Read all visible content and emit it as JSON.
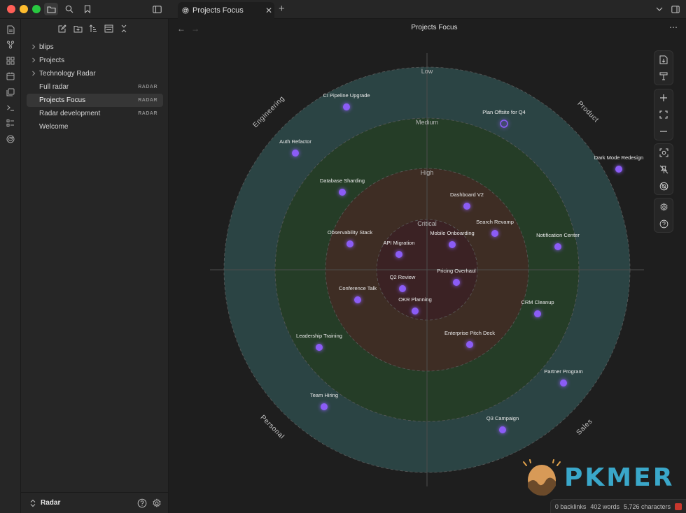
{
  "tab": {
    "title": "Projects Focus"
  },
  "sidebar": {
    "items": [
      {
        "label": "blips",
        "folder": true,
        "badge": ""
      },
      {
        "label": "Projects",
        "folder": true,
        "badge": ""
      },
      {
        "label": "Technology Radar",
        "folder": true,
        "badge": ""
      },
      {
        "label": "Full radar",
        "folder": false,
        "badge": "RADAR"
      },
      {
        "label": "Projects Focus",
        "folder": false,
        "badge": "RADAR",
        "selected": true
      },
      {
        "label": "Radar development",
        "folder": false,
        "badge": "RADAR"
      },
      {
        "label": "Welcome",
        "folder": false,
        "badge": ""
      }
    ],
    "vault_name": "Radar"
  },
  "view": {
    "title": "Projects Focus",
    "back_icon": "arrow-left-icon",
    "forward_icon": "arrow-right-icon",
    "more_label": "⋯"
  },
  "radar": {
    "rings": [
      "Low",
      "Medium",
      "High",
      "Critical"
    ],
    "ring_colors": [
      "#2b4444",
      "#253d27",
      "#3e2d24",
      "#3b2224"
    ],
    "quadrants": [
      "Engineering",
      "Product",
      "Sales",
      "Personal"
    ],
    "blip_color": "#8b5cf6",
    "blips": [
      {
        "label": "CI Pipeline Upgrade",
        "quadrant": "Engineering",
        "ring": "Low"
      },
      {
        "label": "Auth Refactor",
        "quadrant": "Engineering",
        "ring": "Low"
      },
      {
        "label": "Database Sharding",
        "quadrant": "Engineering",
        "ring": "Medium"
      },
      {
        "label": "Observability Stack",
        "quadrant": "Engineering",
        "ring": "High"
      },
      {
        "label": "API Migration",
        "quadrant": "Engineering",
        "ring": "Critical"
      },
      {
        "label": "Plan Offsite for Q4",
        "quadrant": "Product",
        "ring": "Low",
        "hollow": true
      },
      {
        "label": "Dark Mode Redesign",
        "quadrant": "Product",
        "ring": "Low"
      },
      {
        "label": "Notification Center",
        "quadrant": "Product",
        "ring": "Medium"
      },
      {
        "label": "Dashboard V2",
        "quadrant": "Product",
        "ring": "High"
      },
      {
        "label": "Search Revamp",
        "quadrant": "Product",
        "ring": "High"
      },
      {
        "label": "Mobile Onboarding",
        "quadrant": "Product",
        "ring": "Critical"
      },
      {
        "label": "Pricing Overhaul",
        "quadrant": "Sales",
        "ring": "Critical"
      },
      {
        "label": "CRM Cleanup",
        "quadrant": "Sales",
        "ring": "Medium"
      },
      {
        "label": "Enterprise Pitch Deck",
        "quadrant": "Sales",
        "ring": "High"
      },
      {
        "label": "Partner Program",
        "quadrant": "Sales",
        "ring": "Low"
      },
      {
        "label": "Q3 Campaign",
        "quadrant": "Sales",
        "ring": "Low"
      },
      {
        "label": "Q2 Review",
        "quadrant": "Personal",
        "ring": "Critical"
      },
      {
        "label": "OKR Planning",
        "quadrant": "Personal",
        "ring": "Critical"
      },
      {
        "label": "Conference Talk",
        "quadrant": "Personal",
        "ring": "High"
      },
      {
        "label": "Leadership Training",
        "quadrant": "Personal",
        "ring": "Medium"
      },
      {
        "label": "Team Hiring",
        "quadrant": "Personal",
        "ring": "Low"
      }
    ]
  },
  "status": {
    "backlinks": "0 backlinks",
    "words": "402 words",
    "characters": "5,726 characters"
  },
  "watermark": {
    "text": "PKMER"
  }
}
